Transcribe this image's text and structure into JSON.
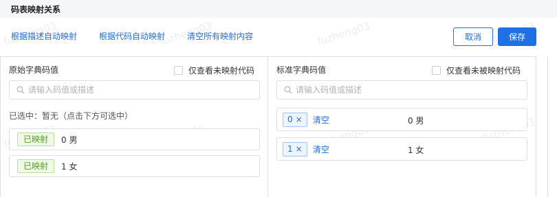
{
  "header": {
    "title": "码表映射关系"
  },
  "watermark": "fuzheng03",
  "actions": {
    "auto_by_desc": "根据描述自动映射",
    "auto_by_code": "根据代码自动映射",
    "clear_all": "清空所有映射内容"
  },
  "buttons": {
    "cancel": "取消",
    "save": "保存"
  },
  "left_panel": {
    "title": "原始字典码值",
    "checkbox_label": "仅查看未映射代码",
    "search_placeholder": "请输入码值或描述",
    "selected_text": "已选中：暂无（点击下方可选中）",
    "rows": [
      {
        "tag": "已映射",
        "label": "0 男"
      },
      {
        "tag": "已映射",
        "label": "1 女"
      }
    ]
  },
  "right_panel": {
    "title": "标准字典码值",
    "checkbox_label": "仅查看未被映射代码",
    "search_placeholder": "请输入码值或描述",
    "rows": [
      {
        "code": "0",
        "close": "×",
        "clear": "清空",
        "value": "0 男"
      },
      {
        "code": "1",
        "close": "×",
        "clear": "清空",
        "value": "1 女"
      }
    ]
  },
  "colors": {
    "primary": "#1f6fe5",
    "mapped_green": "#52a31a",
    "border": "#dcdfe6"
  },
  "icons": {
    "search": "search-icon",
    "checkbox": "checkbox-icon",
    "close": "close-icon"
  }
}
